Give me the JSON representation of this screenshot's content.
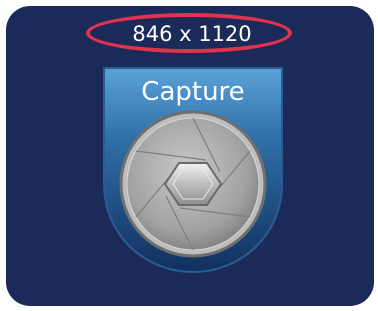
{
  "resolution": {
    "text": "846 x 1120",
    "highlight_color": "#e2324e"
  },
  "capture": {
    "label": "Capture",
    "icon": "camera-aperture-icon"
  },
  "colors": {
    "panel_background": "#1c2a5a",
    "badge_top": "#4a8fc7",
    "badge_bottom": "#143a6e",
    "label_text": "#ffffff"
  }
}
